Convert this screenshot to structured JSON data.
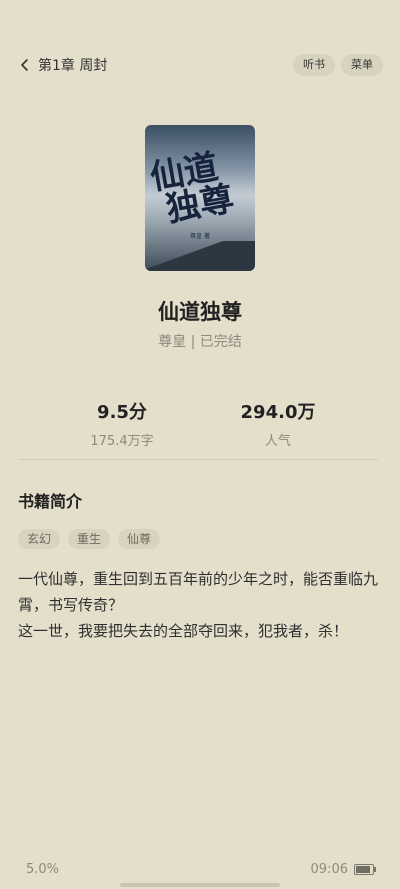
{
  "header": {
    "chapter_label": "第1章 周封",
    "listen_label": "听书",
    "menu_label": "菜单"
  },
  "book": {
    "cover": {
      "title_line1": "仙道",
      "title_line2": "独尊",
      "author_mark": "尊皇 著"
    },
    "title": "仙道独尊",
    "meta": "尊皇 | 已完结",
    "stats": [
      {
        "value": "9.5分",
        "label": "175.4万字"
      },
      {
        "value": "294.0万",
        "label": "人气"
      }
    ]
  },
  "intro": {
    "section_title": "书籍简介",
    "tags": [
      "玄幻",
      "重生",
      "仙尊"
    ],
    "lines": [
      "一代仙尊，重生回到五百年前的少年之时，能否重临九霄，书写传奇？",
      "这一世，我要把失去的全部夺回来，犯我者，杀！"
    ]
  },
  "footer": {
    "progress": "5.0%",
    "time": "09:06"
  },
  "colors": {
    "background": "#e4dfcb",
    "pill": "#d8d3bf",
    "muted_text": "#8d8a7e"
  }
}
